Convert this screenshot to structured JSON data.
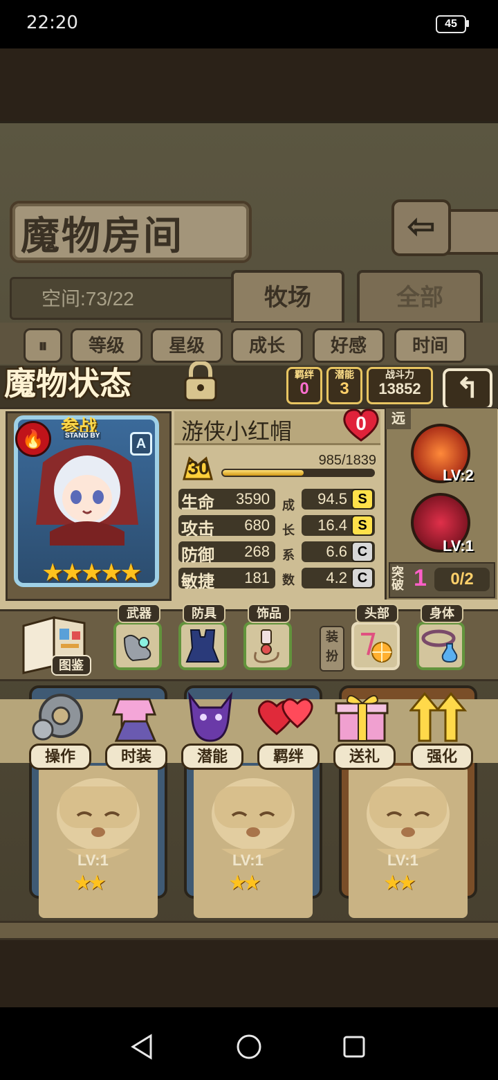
{
  "status_bar": {
    "time": "22:20",
    "battery": "45"
  },
  "room": {
    "title": "魔物房间",
    "space": "空间:73/22",
    "tabs": [
      "牧场",
      "全部"
    ],
    "filters": [
      "等级",
      "星级",
      "成长",
      "好感",
      "时间"
    ],
    "sort_icon": "sort-icon"
  },
  "state": {
    "title": "魔物状态",
    "bond_label": "羁绊",
    "bond_value": "0",
    "potential_label": "潜能",
    "potential_value": "3",
    "power_label": "战斗力",
    "power_value": "13852"
  },
  "monster": {
    "name": "游侠小红帽",
    "standby": "参战",
    "standby_sub": "STAND BY",
    "rank": "A",
    "stars": 5,
    "affinity": "0",
    "level": "30",
    "exp_text": "985/1839",
    "exp_fraction": 0.536,
    "stats": [
      {
        "name": "生命",
        "value": "3590",
        "growth": "94.5",
        "grade": "S"
      },
      {
        "name": "攻击",
        "value": "680",
        "growth": "16.4",
        "grade": "S"
      },
      {
        "name": "防御",
        "value": "268",
        "growth": "6.6",
        "grade": "C"
      },
      {
        "name": "敏捷",
        "value": "181",
        "growth": "4.2",
        "grade": "C"
      }
    ],
    "growth_label": [
      "成",
      "长",
      "系",
      "数"
    ],
    "range": "远",
    "skills": [
      {
        "level": "LV:2"
      },
      {
        "level": "LV:1"
      }
    ],
    "breakthrough_label": "突破",
    "breakthrough_value": "1",
    "breakthrough_progress": "0/2"
  },
  "equipment": {
    "book_label": "图鉴",
    "slots": [
      "武器",
      "防具",
      "饰品"
    ],
    "outfit_tag": "装扮",
    "outfit_slots": [
      "头部",
      "身体"
    ]
  },
  "actions": [
    "操作",
    "时装",
    "潜能",
    "羁绊",
    "送礼",
    "强化"
  ],
  "grid": {
    "cards": [
      {
        "level": "LV:1"
      },
      {
        "level": "LV:1"
      },
      {
        "level": "LV:1"
      }
    ]
  },
  "colors": {
    "gold": "#ffc21e",
    "panel": "#cdbd94",
    "dark": "#3a3124",
    "grade_s": "#ffe14a",
    "grade_c": "#d8d8d8"
  }
}
